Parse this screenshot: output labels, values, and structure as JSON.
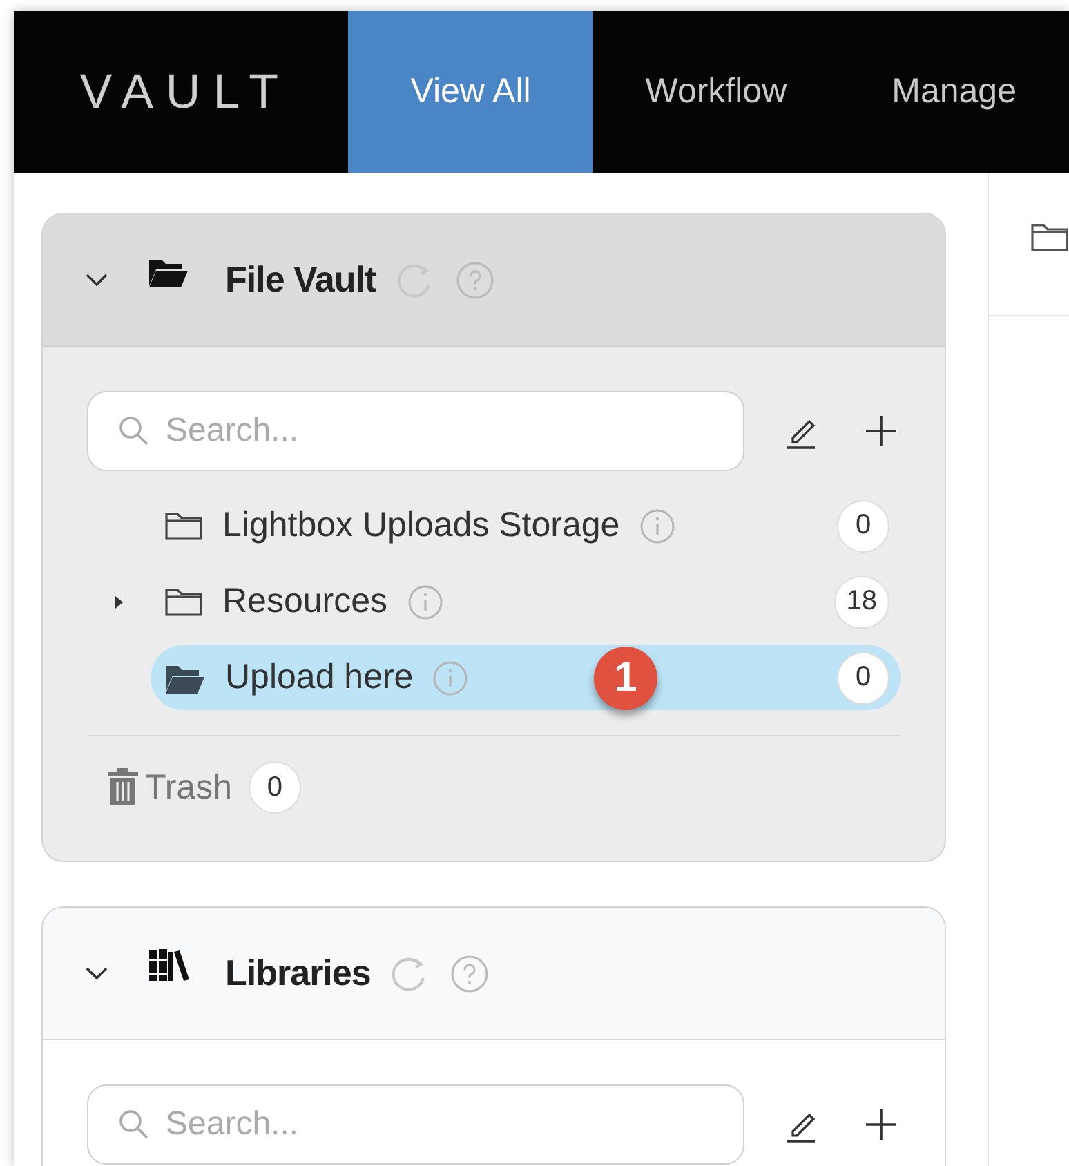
{
  "nav": {
    "logo": "VAULT",
    "tabs": [
      {
        "label": "View All",
        "selected": true
      },
      {
        "label": "Workflow",
        "selected": false
      },
      {
        "label": "Manage",
        "selected": false
      }
    ]
  },
  "panels": [
    {
      "title": "File Vault",
      "active": true,
      "expanded": true,
      "search": {
        "placeholder": "Search..."
      },
      "folders": [
        {
          "name": "Lightbox Uploads Storage",
          "count": "0",
          "has_children": false,
          "selected": false
        },
        {
          "name": "Resources",
          "count": "18",
          "has_children": true,
          "selected": false
        },
        {
          "name": "Upload here",
          "count": "0",
          "has_children": false,
          "selected": true,
          "callout": "1"
        }
      ],
      "trash": {
        "label": "Trash",
        "count": "0"
      }
    },
    {
      "title": "Libraries",
      "active": false,
      "expanded": true,
      "search": {
        "placeholder": "Search..."
      }
    }
  ]
}
